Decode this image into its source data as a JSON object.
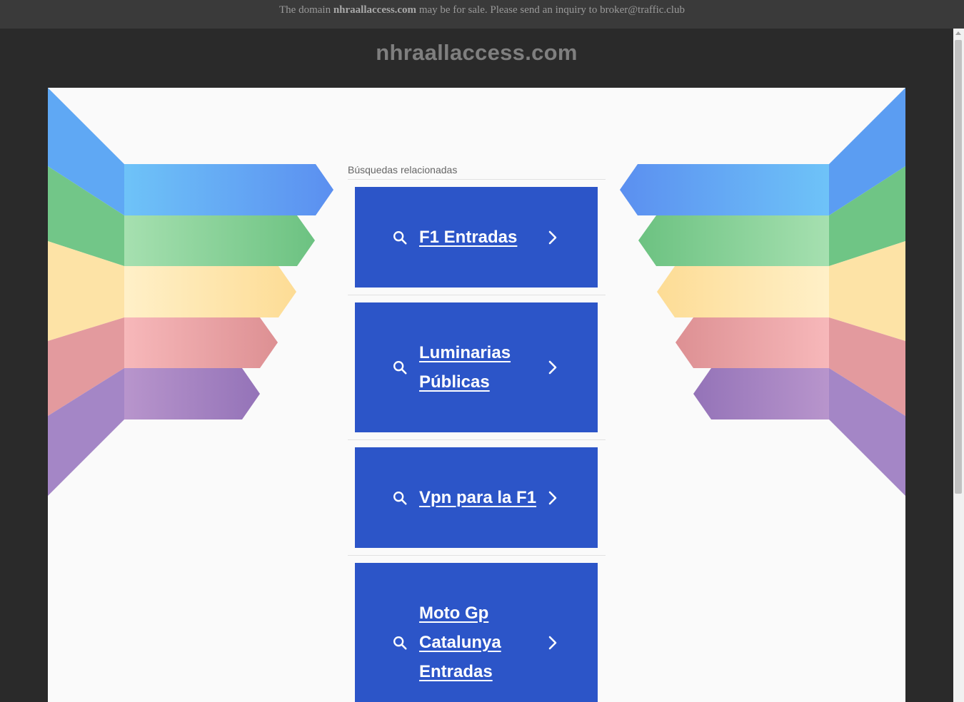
{
  "banner": {
    "prefix": "The domain ",
    "domain": "nhraallaccess.com",
    "suffix": " may be for sale. Please send an inquiry to broker@traffic.club"
  },
  "site": {
    "title": "nhraallaccess.com"
  },
  "related": {
    "title": "Búsquedas relacionadas",
    "items": [
      {
        "label": "F1 Entradas"
      },
      {
        "label": "Luminarias Públicas"
      },
      {
        "label": "Vpn para la F1"
      },
      {
        "label": "Moto Gp Catalunya Entradas"
      }
    ]
  },
  "colors": {
    "result_bg": "#2c55c8",
    "ribbon_blue": "#5aa0f0",
    "ribbon_green": "#7ccf8e",
    "ribbon_yellow": "#fde2a2",
    "ribbon_pink": "#e9a2a5",
    "ribbon_purple": "#a07cc0"
  },
  "icons": {
    "search": "search-icon",
    "chevron": "chevron-right-icon"
  }
}
